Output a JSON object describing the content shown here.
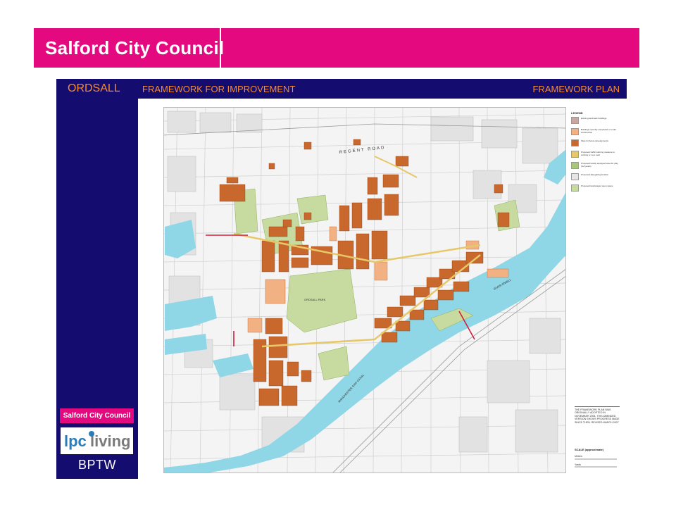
{
  "header": {
    "title": "Salford City Council"
  },
  "plan": {
    "area": "ORDSALL",
    "document": "FRAMEWORK FOR IMPROVEMENT",
    "sheet": "FRAMEWORK PLAN"
  },
  "legend": {
    "title": "LEGEND",
    "items": [
      {
        "label": "Existing landmark buildings",
        "color": "#c9a6a0"
      },
      {
        "label": "Buildings recently completed or under construction",
        "color": "#f2b183"
      },
      {
        "label": "Sites for future developments",
        "color": "#c8682d"
      },
      {
        "label": "Proposed traffic calming measure to existing or new road",
        "color": "#e6c868"
      },
      {
        "label": "Proposed locally equipped area for play (4-8 years)",
        "color": "#a9c77a"
      },
      {
        "label": "Proposed alleygating location",
        "color": "#e6e6e6"
      },
      {
        "label": "Proposed landscaped open space",
        "color": "#c7dba0"
      }
    ]
  },
  "note": "THE FRAMEWORK PLAN WAS ORIGINALLY ADOPTED IN NOVEMBER 2004. THIS AMENDED VERSION SHOWS PROGRESS MADE SINCE THEN. REVISED MARCH 2007",
  "scale": {
    "title": "SCALE (approximate)",
    "units": [
      "Metres",
      "Yards"
    ]
  },
  "map_labels": {
    "road_north": "REGENT ROAD",
    "park": "ORDSALL PARK",
    "river": "RIVER IRWELL",
    "canal": "MANCHESTER SHIP CANAL"
  },
  "logos": {
    "council": "Salford City Council",
    "lpc": "lpc living",
    "bptw": "BPTW"
  },
  "colors": {
    "brand_pink": "#e5097f",
    "navy": "#140c6e",
    "orange_text": "#f38b32",
    "water": "#8fd6e6",
    "development": "#c8682d",
    "green_space": "#c7dba0"
  }
}
